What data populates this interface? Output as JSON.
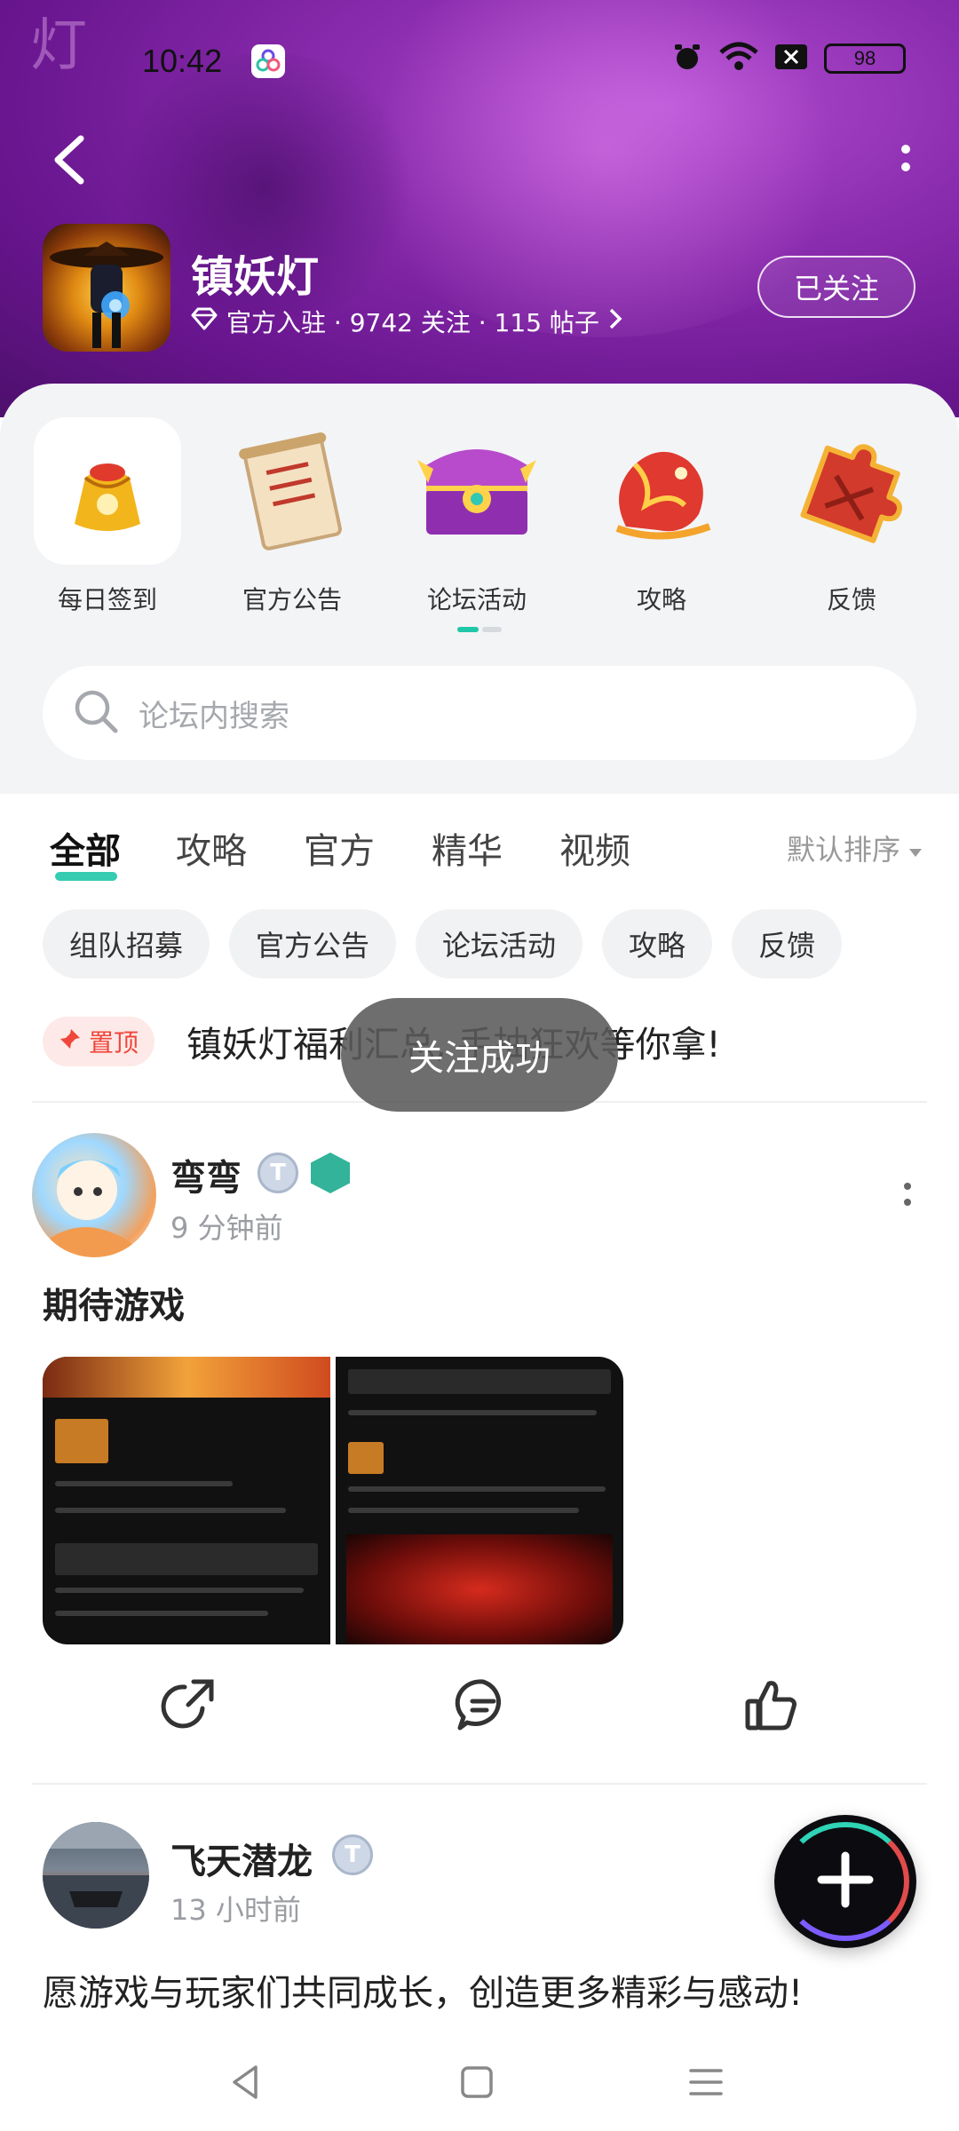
{
  "status_bar": {
    "time": "10:42",
    "battery": "98"
  },
  "header": {
    "title": "镇妖灯",
    "meta": "官方入驻 · 9742 关注 · 115 帖子",
    "follow_label": "已关注",
    "accent_color": "#8a2cae"
  },
  "quick_entries": [
    {
      "label": "每日签到",
      "icon": "lucky-bag-icon"
    },
    {
      "label": "官方公告",
      "icon": "scroll-icon"
    },
    {
      "label": "论坛活动",
      "icon": "treasure-chest-icon"
    },
    {
      "label": "攻略",
      "icon": "dragon-icon"
    },
    {
      "label": "反馈",
      "icon": "puzzle-icon"
    }
  ],
  "search": {
    "placeholder": "论坛内搜索"
  },
  "tabs": [
    {
      "label": "全部",
      "active": true
    },
    {
      "label": "攻略"
    },
    {
      "label": "官方"
    },
    {
      "label": "精华"
    },
    {
      "label": "视频"
    }
  ],
  "sort_label": "默认排序",
  "chips": [
    "组队招募",
    "官方公告",
    "论坛活动",
    "攻略",
    "反馈"
  ],
  "pinned": {
    "badge": "置顶",
    "title": "镇妖灯福利汇总, 手抽狂欢等你拿!"
  },
  "toast": "关注成功",
  "posts": [
    {
      "author": "弯弯",
      "time": "9 分钟前",
      "title": "期待游戏"
    },
    {
      "author": "飞天潜龙",
      "time": "13 小时前",
      "text": "愿游戏与玩家们共同成长，创造更多精彩与感动!"
    }
  ]
}
